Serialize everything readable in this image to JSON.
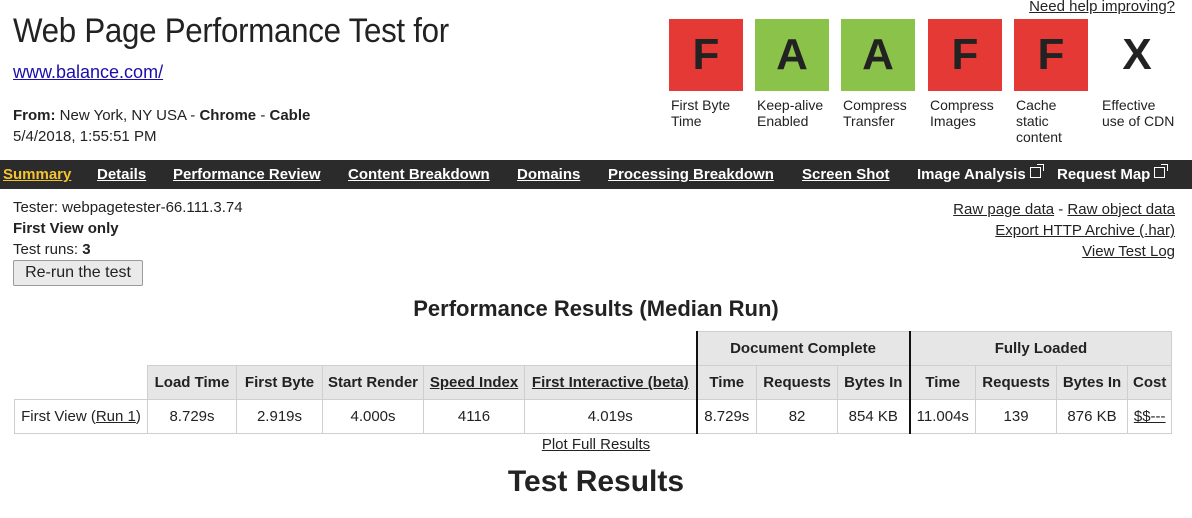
{
  "header": {
    "title": "Web Page Performance Test for",
    "url": "www.balance.com/",
    "from_label": "From:",
    "from_location": "New York, NY USA",
    "from_sep1": " - ",
    "from_browser": "Chrome",
    "from_sep2": " - ",
    "from_connection": "Cable",
    "date": "5/4/2018, 1:55:51 PM",
    "help_link": "Need help improving?"
  },
  "grades": [
    {
      "letter": "F",
      "label": "First Byte Time",
      "color": "#e53935"
    },
    {
      "letter": "A",
      "label": "Keep-alive Enabled",
      "color": "#8bc34a"
    },
    {
      "letter": "A",
      "label": "Compress Transfer",
      "color": "#8bc34a"
    },
    {
      "letter": "F",
      "label": "Compress Images",
      "color": "#e53935"
    },
    {
      "letter": "F",
      "label": "Cache static content",
      "color": "#e53935"
    },
    {
      "letter": "X",
      "label": "Effective use of CDN",
      "color": "#ffffff"
    }
  ],
  "nav": {
    "summary": "Summary",
    "details": "Details",
    "performance_review": "Performance Review",
    "content_breakdown": "Content Breakdown",
    "domains": "Domains",
    "processing_breakdown": "Processing Breakdown",
    "screen_shot": "Screen Shot",
    "image_analysis": "Image Analysis",
    "request_map": "Request Map"
  },
  "info": {
    "tester": "Tester: webpagetester-66.111.3.74",
    "first_view_only": "First View only",
    "test_runs_label": "Test runs: ",
    "test_runs_value": "3",
    "rerun_button": "Re-run the test"
  },
  "links": {
    "raw_page_data": "Raw page data",
    "sep": " - ",
    "raw_object_data": "Raw object data",
    "export_har": "Export HTTP Archive (.har)",
    "view_test_log": "View Test Log"
  },
  "results": {
    "title": "Performance Results (Median Run)",
    "group_doc": "Document Complete",
    "group_full": "Fully Loaded",
    "headers": {
      "load_time": "Load Time",
      "first_byte": "First Byte",
      "start_render": "Start Render",
      "speed_index": "Speed Index",
      "first_interactive": "First Interactive (beta)",
      "doc_time": "Time",
      "doc_requests": "Requests",
      "doc_bytes": "Bytes In",
      "full_time": "Time",
      "full_requests": "Requests",
      "full_bytes": "Bytes In",
      "cost": "Cost"
    },
    "row": {
      "label_prefix": "First View (",
      "run_link": "Run 1",
      "label_suffix": ")",
      "load_time": "8.729s",
      "first_byte": "2.919s",
      "start_render": "4.000s",
      "speed_index": "4116",
      "first_interactive": "4.019s",
      "doc_time": "8.729s",
      "doc_requests": "82",
      "doc_bytes": "854 KB",
      "full_time": "11.004s",
      "full_requests": "139",
      "full_bytes": "876 KB",
      "cost": "$$---"
    },
    "plot_link": "Plot Full Results"
  },
  "test_results_heading": "Test Results"
}
